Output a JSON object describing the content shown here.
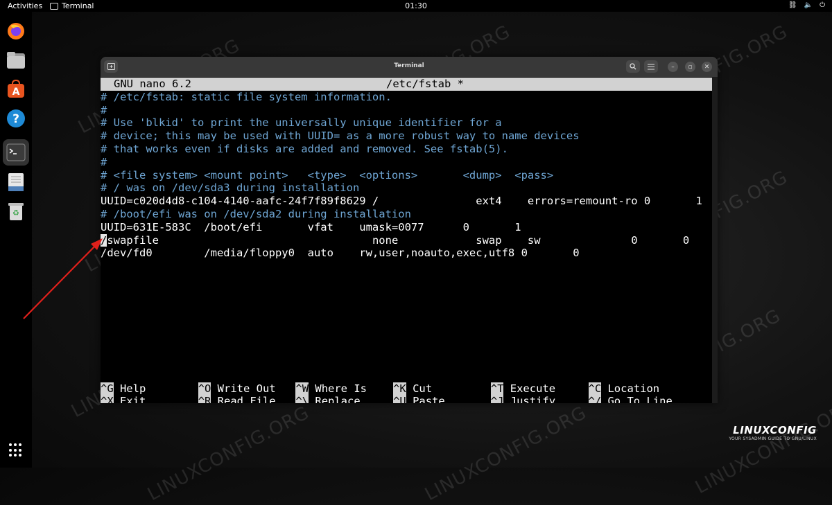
{
  "topbar": {
    "activities": "Activities",
    "app_name": "Terminal",
    "clock": "01:30"
  },
  "dock": {
    "items": [
      "firefox-icon",
      "files-icon",
      "app-center-icon",
      "help-icon",
      "terminal-icon",
      "text-editor-icon",
      "trash-icon"
    ],
    "active": "terminal-icon"
  },
  "watermark": "LINUXCONFIG.ORG",
  "window": {
    "title": "Terminal"
  },
  "nano": {
    "version": "GNU nano 6.2",
    "filename": "/etc/fstab *"
  },
  "file_lines": [
    {
      "text": "# /etc/fstab: static file system information.",
      "comment": true
    },
    {
      "text": "#",
      "comment": true
    },
    {
      "text": "# Use 'blkid' to print the universally unique identifier for a",
      "comment": true
    },
    {
      "text": "# device; this may be used with UUID= as a more robust way to name devices",
      "comment": true
    },
    {
      "text": "# that works even if disks are added and removed. See fstab(5).",
      "comment": true
    },
    {
      "text": "#",
      "comment": true
    },
    {
      "text": "# <file system> <mount point>   <type>  <options>       <dump>  <pass>",
      "comment": true
    },
    {
      "text": "# / was on /dev/sda3 during installation",
      "comment": true
    },
    {
      "text": "UUID=c020d4d8-c104-4140-aafc-24f7f89f8629 /               ext4    errors=remount-ro 0       1",
      "comment": false
    },
    {
      "text": "# /boot/efi was on /dev/sda2 during installation",
      "comment": true
    },
    {
      "text": "UUID=631E-583C  /boot/efi       vfat    umask=0077      0       1",
      "comment": false
    },
    {
      "text": "/swapfile                                 none            swap    sw              0       0",
      "comment": false,
      "cursor": true
    },
    {
      "text": "/dev/fd0        /media/floppy0  auto    rw,user,noauto,exec,utf8 0       0",
      "comment": false
    }
  ],
  "shortcuts": [
    {
      "key": "^G",
      "label": "Help"
    },
    {
      "key": "^O",
      "label": "Write Out"
    },
    {
      "key": "^W",
      "label": "Where Is"
    },
    {
      "key": "^K",
      "label": "Cut"
    },
    {
      "key": "^T",
      "label": "Execute"
    },
    {
      "key": "^C",
      "label": "Location"
    },
    {
      "key": "^X",
      "label": "Exit"
    },
    {
      "key": "^R",
      "label": "Read File"
    },
    {
      "key": "^\\",
      "label": "Replace"
    },
    {
      "key": "^U",
      "label": "Paste"
    },
    {
      "key": "^J",
      "label": "Justify"
    },
    {
      "key": "^/",
      "label": "Go To Line"
    }
  ],
  "logo": {
    "name": "LINUXCONFIG",
    "tagline": "YOUR SYSADMIN GUIDE TO GNU/LINUX"
  },
  "colors": {
    "comment": "#6fa6d4",
    "highlight_bar": "#d2d2d2",
    "arrow": "#e0201b"
  }
}
